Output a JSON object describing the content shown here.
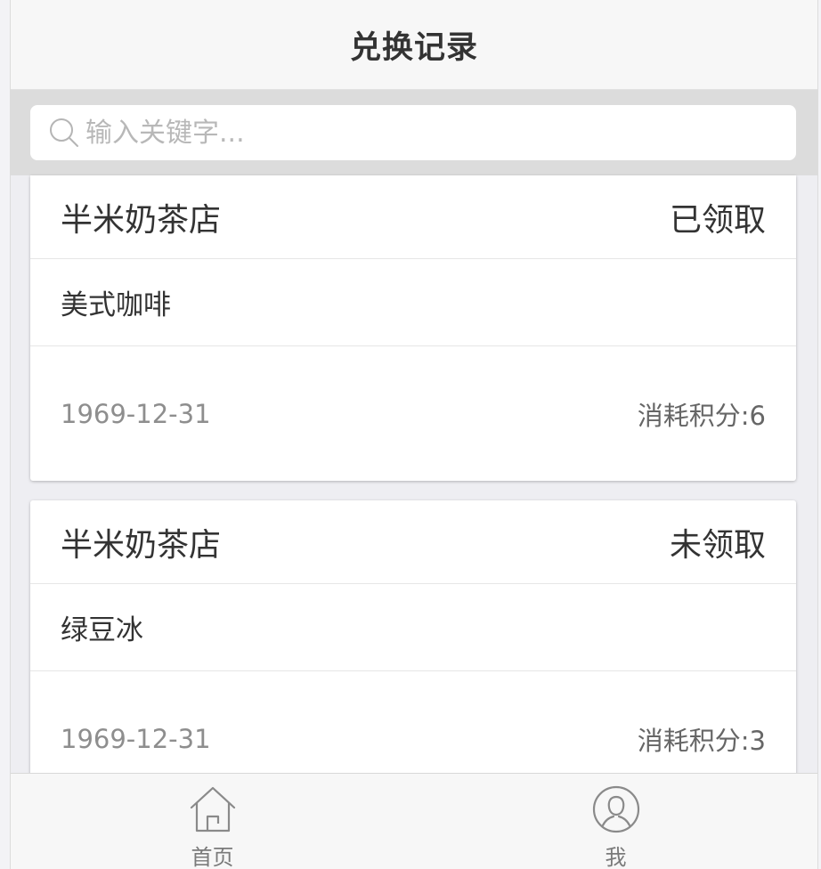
{
  "header": {
    "title": "兑换记录"
  },
  "search": {
    "placeholder": "输入关键字..."
  },
  "records": [
    {
      "shop": "半米奶茶店",
      "status": "已领取",
      "item": "美式咖啡",
      "date": "1969-12-31",
      "points": "消耗积分:6"
    },
    {
      "shop": "半米奶茶店",
      "status": "未领取",
      "item": "绿豆冰",
      "date": "1969-12-31",
      "points": "消耗积分:3"
    }
  ],
  "tabbar": {
    "items": [
      {
        "label": "首页",
        "icon": "home-icon"
      },
      {
        "label": "我",
        "icon": "user-icon"
      }
    ]
  },
  "colors": {
    "text_primary": "#333333",
    "text_muted": "#8e8e8e",
    "header_bg": "#f7f7f7",
    "search_bar_bg": "#dcdcdc"
  }
}
